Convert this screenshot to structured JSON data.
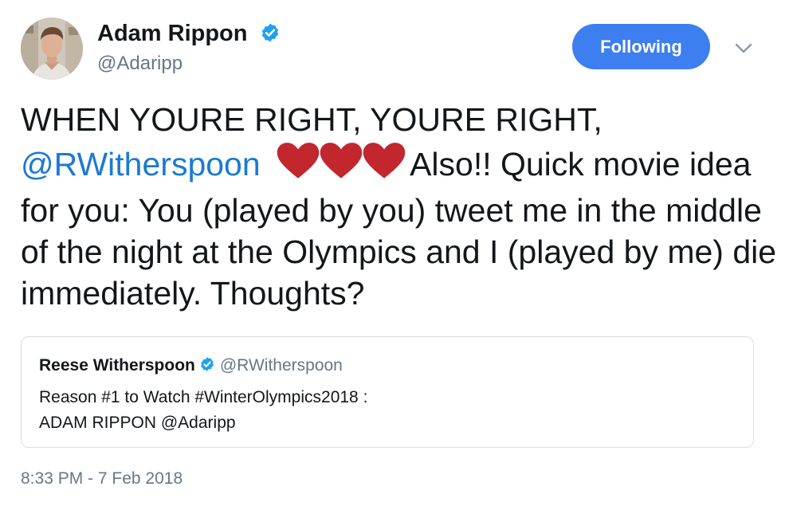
{
  "author": {
    "display_name": "Adam Rippon",
    "handle": "@Adaripp",
    "verified": true,
    "avatar_icon": "profile-photo"
  },
  "follow_button": {
    "label": "Following",
    "color": "#3d7ef0"
  },
  "menu": {
    "icon": "chevron-down-icon"
  },
  "tweet": {
    "text_line1": "WHEN YOURE RIGHT, YOURE RIGHT,",
    "mention": "@RWitherspoon",
    "emoji": [
      "red-heart",
      "red-heart",
      "red-heart"
    ],
    "text_after_emoji": "Also!! Quick movie idea for you: You (played by you) tweet me in the middle of the night at the Olympics and I (played by me) die immediately.  Thoughts?"
  },
  "quoted_tweet": {
    "display_name": "Reese Witherspoon",
    "handle": "@RWitherspoon",
    "verified": true,
    "line1": "Reason #1 to Watch #WinterOlympics2018 :",
    "line2": "ADAM RIPPON @Adaripp"
  },
  "timestamp": "8:33 PM - 7 Feb 2018",
  "colors": {
    "link": "#1b7ad2",
    "verified": "#1da1f2",
    "heart": "#c1272d",
    "muted": "#657786"
  }
}
